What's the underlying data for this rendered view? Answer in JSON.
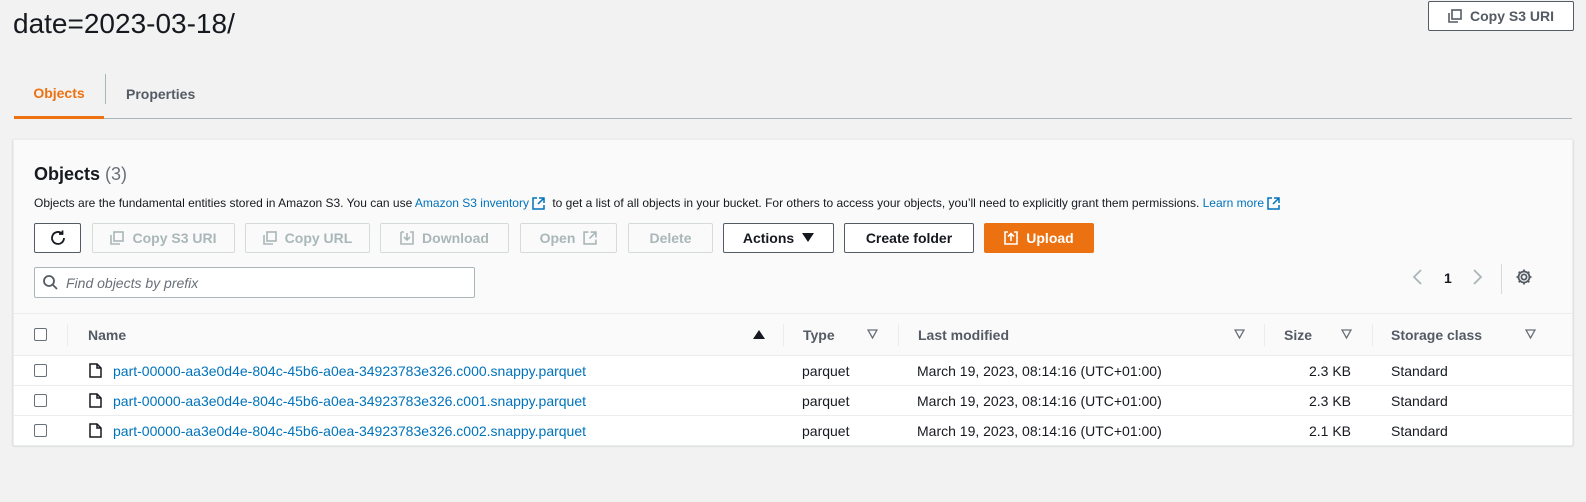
{
  "page": {
    "title": "date=2023-03-18/"
  },
  "header": {
    "copy_s3_uri_label": "Copy S3 URI"
  },
  "tabs": [
    {
      "label": "Objects",
      "active": true
    },
    {
      "label": "Properties",
      "active": false
    }
  ],
  "objects_panel": {
    "title": "Objects",
    "count": "(3)",
    "description_part1": "Objects are the fundamental entities stored in Amazon S3. You can use ",
    "inventory_link": "Amazon S3 inventory",
    "description_part2": " to get a list of all objects in your bucket. For others to access your objects, you’ll need to explicitly grant them permissions. ",
    "learn_more_link": "Learn more"
  },
  "toolbar": {
    "refresh_icon": "refresh-icon",
    "copy_s3_uri_label": "Copy S3 URI",
    "copy_url_label": "Copy URL",
    "download_label": "Download",
    "open_label": "Open",
    "delete_label": "Delete",
    "actions_label": "Actions",
    "create_folder_label": "Create folder",
    "upload_label": "Upload"
  },
  "search": {
    "placeholder": "Find objects by prefix",
    "value": ""
  },
  "pagination": {
    "current_page": "1"
  },
  "table": {
    "columns": {
      "name": "Name",
      "type": "Type",
      "last_modified": "Last modified",
      "size": "Size",
      "storage_class": "Storage class"
    },
    "rows": [
      {
        "name": "part-00000-aa3e0d4e-804c-45b6-a0ea-34923783e326.c000.snappy.parquet",
        "type": "parquet",
        "last_modified": "March 19, 2023, 08:14:16 (UTC+01:00)",
        "size": "2.3 KB",
        "storage_class": "Standard"
      },
      {
        "name": "part-00000-aa3e0d4e-804c-45b6-a0ea-34923783e326.c001.snappy.parquet",
        "type": "parquet",
        "last_modified": "March 19, 2023, 08:14:16 (UTC+01:00)",
        "size": "2.3 KB",
        "storage_class": "Standard"
      },
      {
        "name": "part-00000-aa3e0d4e-804c-45b6-a0ea-34923783e326.c002.snappy.parquet",
        "type": "parquet",
        "last_modified": "March 19, 2023, 08:14:16 (UTC+01:00)",
        "size": "2.1 KB",
        "storage_class": "Standard"
      }
    ]
  },
  "colors": {
    "accent": "#ec7211",
    "link": "#0073bb",
    "text": "#16191f",
    "disabled": "#aab7b8"
  }
}
